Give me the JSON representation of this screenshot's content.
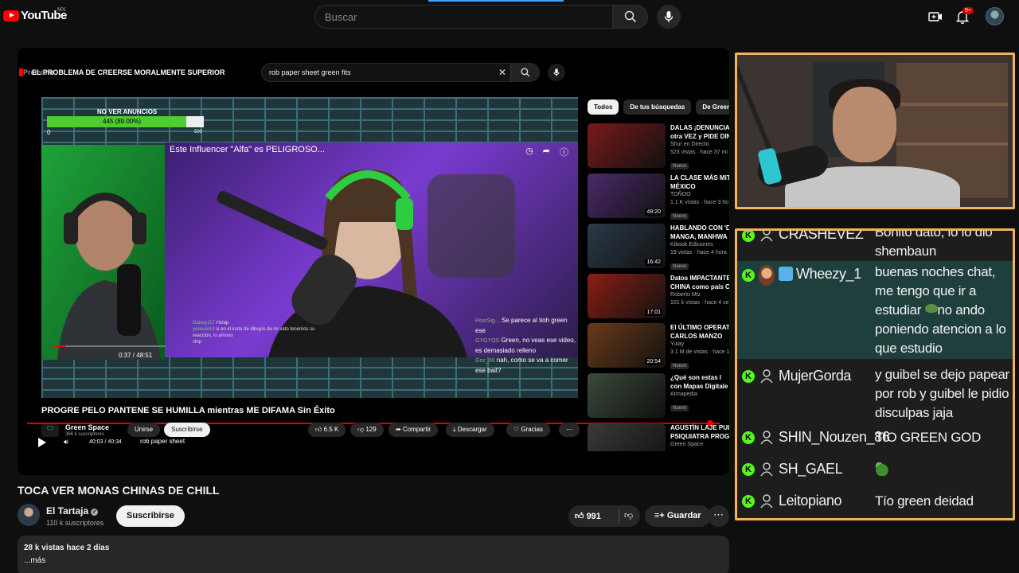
{
  "app": {
    "logo_text": "YouTube",
    "logo_country": "MX",
    "notifications_badge": "9+"
  },
  "search": {
    "placeholder": "Buscar"
  },
  "embedded": {
    "inner_premium": "Premium",
    "inner_title": "EL PROBLEMA DE CREERSE MORALMENTE SUPERIOR",
    "inner_search_query": "rob paper sheet green fits",
    "ad_bar": {
      "label": "NO VER ANUNCIOS",
      "progress_text": "445 (89.00%)",
      "progress": 0.89,
      "min": "0",
      "max": "500"
    },
    "inner_video_title": "Este Influencer \"Alfa\" es PELIGROSO...",
    "inner_video_time": "0:37 / 48:51",
    "mini_chat": [
      {
        "user": "Daisey117",
        "text": "Holap"
      },
      {
        "user": "yeeesei14",
        "text": "si en el insta de dibujos de mi vato tenemos su reacción, lo amooo"
      },
      {
        "user": "",
        "text": "chip"
      }
    ],
    "right_chat": [
      {
        "user": "PoorSig...",
        "text": "Se parece al tioh green ese"
      },
      {
        "user": "GYGYOS",
        "text": "Green, no veas ese video, es demasiado relleno"
      },
      {
        "user": "Gnz_00",
        "text": "nah, como se va a comer ese bait?"
      }
    ],
    "video_title": "PROGRE PELO PANTENE SE HUMILLA mientras ME DIFAMA Sin Éxito",
    "current_time": "40:03 / 40:34",
    "channel": {
      "name": "Green Space",
      "subs": "366 k suscriptores"
    },
    "join_label": "Unirse",
    "subscribe_label": "Suscribirse",
    "search_chip": "rob paper sheet",
    "actions": {
      "likes": "6.5 K",
      "dislikes": "129",
      "share": "Compartir",
      "download": "Descargar",
      "thanks": "Gracias"
    },
    "rail_chips": [
      "Todos",
      "De tus búsquedas",
      "De Green Sp"
    ],
    "rail": [
      {
        "title": "DALAS ¡DENUNCIA...",
        "title2": "otra VEZ y PIDE DIN",
        "channel": "Shur en Directo",
        "meta": "523 vistas · hace 37 mi",
        "badge": "Nuevo",
        "duration": "",
        "thumb_color": "#7a1a1a"
      },
      {
        "title": "LA CLASE MÁS MIT",
        "title2": "MÉXICO",
        "channel": "TOÑOO",
        "meta": "1.1 K vistas · hace 3 ho",
        "badge": "Nuevo",
        "duration": "49:20",
        "thumb_color": "#4b2a6a"
      },
      {
        "title": "HABLANDO CON 'D",
        "title2": "MANGA, MANHWA",
        "channel": "Kibook Ediciones",
        "meta": "19 vistas · hace 4 hora",
        "badge": "Nuevo",
        "duration": "16:42",
        "thumb_color": "#2a3a4a"
      },
      {
        "title": "Datos IMPACTANTE",
        "title2": "CHINA como país C",
        "channel": "Roberto Mtz",
        "meta": "101 k vistas · hace 4 se",
        "badge": "",
        "duration": "17:01",
        "thumb_color": "#8a1f14"
      },
      {
        "title": "El ÚLTIMO OPERATI",
        "title2": "CARLOS MANZO",
        "channel": "Yulay",
        "meta": "3.1 M de vistas · hace 1",
        "badge": "Nuevo",
        "duration": "20:54",
        "thumb_color": "#6b3a1a"
      },
      {
        "title": "¿Qué son estas l",
        "title2": "con Mapas Digitale",
        "channel": "Armapedia",
        "meta": "",
        "badge": "Nuevo",
        "duration": "",
        "thumb_color": "#3a4a3a"
      },
      {
        "title": "AGUSTÍN LAJE PUL",
        "title2": "PSIQUIATRA PROGR",
        "channel": "Green Space",
        "meta": "",
        "badge": "",
        "duration": "",
        "thumb_color": "#3a3a3a"
      }
    ]
  },
  "video": {
    "title": "TOCA VER MONAS CHINAS DE CHILL",
    "channel_name": "El Tartaja",
    "subscribers": "110 k suscriptores",
    "subscribe_label": "Suscribirse",
    "likes": "991",
    "save_label": "Guardar",
    "views_date": "28 k vistas  hace 2 días",
    "more_label": "...más"
  },
  "chat": {
    "messages": [
      {
        "user": "CRASHEVEZ",
        "text": "Bonito dato, lo lo dio shembaun",
        "highlight": false
      },
      {
        "user": "Wheezy_1",
        "text": "buenas noches chat, me tengo que ir a estudiar",
        "text2": "no ando poniendo atencion a lo que estudio",
        "highlight": true
      },
      {
        "user": "MujerGorda",
        "text": "y guibel se dejo papear por rob y guibel le pidio disculpas jaja",
        "highlight": false
      },
      {
        "user": "SHIN_Nouzen_86",
        "text": "TIO GREEN GOD",
        "highlight": false
      },
      {
        "user": "SH_GAEL",
        "text": "",
        "highlight": false
      },
      {
        "user": "Leitopiano",
        "text": "Tío green deidad",
        "highlight": false
      }
    ],
    "kick_glyph": "K"
  },
  "colors": {
    "accent_red": "#ff0000",
    "overlay_border": "#f2b35a",
    "kick_green": "#53fc18",
    "chat_highlight": "#1e3f3c"
  }
}
